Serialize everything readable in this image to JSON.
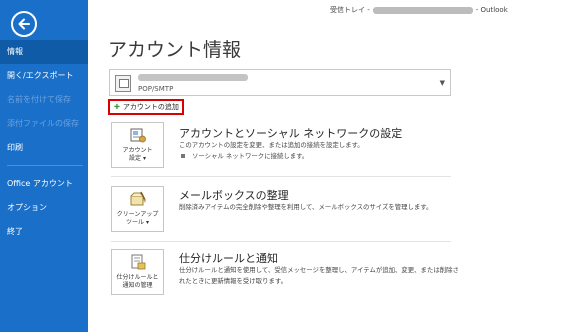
{
  "window": {
    "title_prefix": "受信トレイ -",
    "title_suffix": "- Outlook"
  },
  "sidebar": {
    "items": [
      {
        "label": "情報"
      },
      {
        "label": "開く/エクスポート"
      },
      {
        "label": "名前を付けて保存"
      },
      {
        "label": "添付ファイルの保存"
      },
      {
        "label": "印刷"
      },
      {
        "label": "Office アカウント"
      },
      {
        "label": "オプション"
      },
      {
        "label": "終了"
      }
    ]
  },
  "page": {
    "title": "アカウント情報"
  },
  "account": {
    "type": "POP/SMTP"
  },
  "add_account": {
    "label": "アカウントの追加"
  },
  "sections": [
    {
      "button_label": "アカウント\n設定 ▾",
      "title": "アカウントとソーシャル ネットワークの設定",
      "description": "このアカウントの設定を変更、または追加の接続を設定します。",
      "bullet": "ソーシャル ネットワークに接続します。"
    },
    {
      "button_label": "クリーンアップ\nツール ▾",
      "title": "メールボックスの整理",
      "description": "削除済みアイテムの完全削除や整理を利用して、メールボックスのサイズを管理します。"
    },
    {
      "button_label": "仕分けルールと\n通知の管理",
      "title": "仕分けルールと通知",
      "description": "仕分けルールと通知を使用して、受信メッセージを整理し、アイテムが追加、変更、または削除されたときに更新情報を受け取ります。"
    }
  ],
  "colors": {
    "sidebar_bg": "#1a70c9",
    "sidebar_active": "#0f5ba8",
    "highlight_border": "#d90000",
    "add_plus": "#3f9a3f"
  },
  "icons": {
    "back": "back-arrow-icon",
    "account": "account-card-icon",
    "dropdown": "chevron-down-icon",
    "add": "plus-icon",
    "settings": "account-settings-icon",
    "cleanup": "cleanup-tools-icon",
    "rules": "rules-alerts-icon"
  }
}
